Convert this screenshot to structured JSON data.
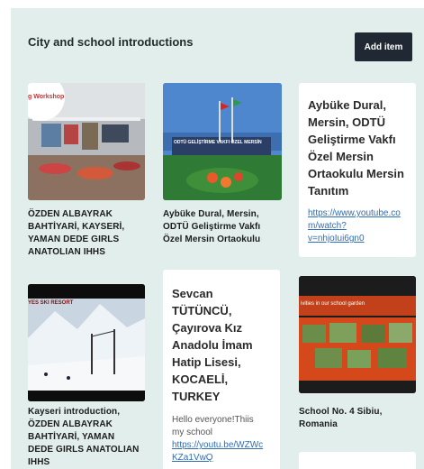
{
  "header": {
    "title": "City and school introductions",
    "add_button_label": "Add item"
  },
  "cards": [
    {
      "id": "card-1",
      "thumb_label": "g Workshop",
      "caption_lines": [
        "ÖZDEN ALBAYRAK",
        "BAHTİYARİ, KAYSERİ,",
        "YAMAN DEDE GIRLS",
        "ANATOLIAN IHHS"
      ]
    },
    {
      "id": "card-2",
      "thumb_label": "ODTÜ GELİŞTİRME VAKFI ÖZEL MERSİN",
      "caption_lines": [
        "Aybüke Dural, Mersin,",
        "ODTÜ Geliştirme Vakfı",
        "Özel Mersin Ortaokulu"
      ]
    },
    {
      "id": "card-3",
      "title_lines": [
        "Aybüke Dural,",
        "Mersin, ODTÜ",
        "Geliştirme Vakfı",
        "Özel Mersin",
        "Ortaokulu Mersin",
        "Tanıtım"
      ],
      "link_lines": [
        "https://www.youtube.co",
        "m/watch?",
        "v=nhjoIui6gn0"
      ]
    },
    {
      "id": "card-4",
      "thumb_label": "YES SKI RESORT",
      "caption_lines": [
        "Kayseri introduction,",
        "ÖZDEN ALBAYRAK",
        "BAHTİYARİ, YAMAN",
        "DEDE GIRLS ANATOLIAN",
        "IHHS"
      ]
    },
    {
      "id": "card-5",
      "title_lines": [
        "Sevcan",
        "TÜTÜNCÜ,",
        "Çayırova Kız",
        "Anadolu İmam",
        "Hatip Lisesi,",
        "KOCAELİ,",
        "TURKEY"
      ],
      "body_lines": [
        "Hello everyone!Thiis",
        "my school"
      ],
      "link_lines": [
        "https://youtu.be/WZWc",
        "KZa1VwQ"
      ]
    },
    {
      "id": "card-6",
      "thumb_label": "ivities in our school garden",
      "caption_lines": [
        "School No. 4 Sibiu,",
        "Romania"
      ]
    }
  ],
  "colors": {
    "board_bg": "#e1eeeb",
    "button_bg": "#1f2833",
    "link": "#2f6db5"
  }
}
